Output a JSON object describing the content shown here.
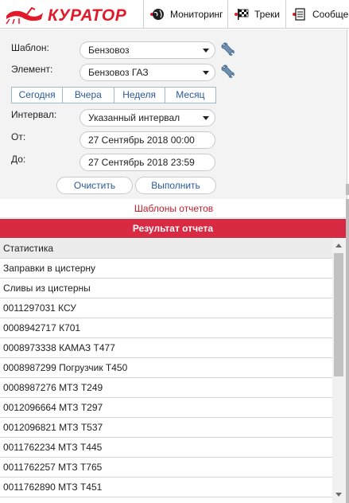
{
  "brand": {
    "logo_text": "КУРАТОР",
    "accent": "#e01a2a"
  },
  "nav": [
    {
      "label": "Мониторинг",
      "icon": "globe-icon"
    },
    {
      "label": "Треки",
      "icon": "checkered-flag-icon"
    },
    {
      "label": "Сообще",
      "icon": "document-icon"
    }
  ],
  "form": {
    "template_label": "Шаблон:",
    "template_value": "Бензовоз",
    "element_label": "Элемент:",
    "element_value": "Бензовоз ГАЗ",
    "periods": [
      "Сегодня",
      "Вчера",
      "Неделя",
      "Месяц"
    ],
    "interval_label": "Интервал:",
    "interval_value": "Указанный интервал",
    "from_label": "От:",
    "from_value": "27 Сентябрь 2018 00:00",
    "to_label": "До:",
    "to_value": "27 Сентябрь 2018 23:59",
    "clear_label": "Очистить",
    "execute_label": "Выполнить"
  },
  "report_templates_link": "Шаблоны отчетов",
  "result_title": "Результат отчета",
  "table": {
    "header": "Статистика",
    "rows": [
      "Заправки в цистерну",
      "Сливы из цистерны",
      "0011297031 КСУ",
      "0008942717 К701",
      "0008973338 КАМАЗ Т477",
      "0008987299 Погрузчик Т450",
      "0008987276 МТЗ Т249",
      "0012096664 МТЗ Т297",
      "0012096821 МТЗ Т537",
      "0011762234 МТЗ Т445",
      "0011762257 МТЗ Т765",
      "0011762890 МТЗ Т451"
    ]
  },
  "colors": {
    "result_bar": "#d92a44",
    "link": "#c3202e",
    "button_text": "#2a5a9a"
  }
}
